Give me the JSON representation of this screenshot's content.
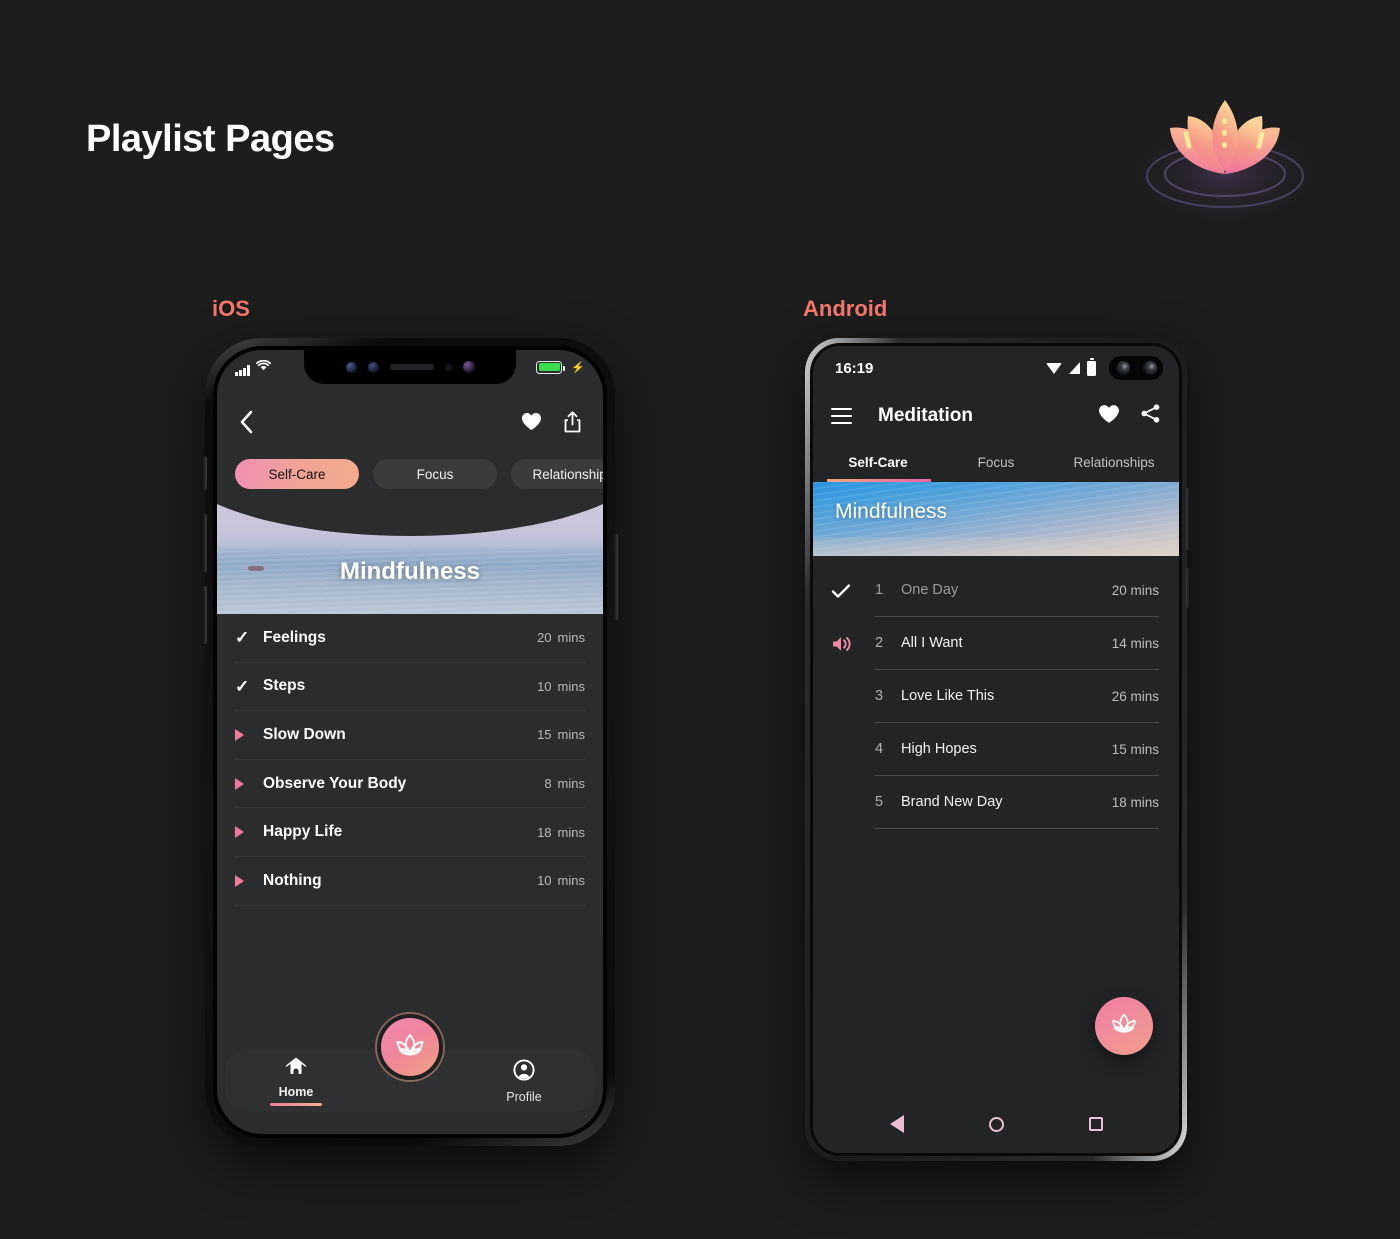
{
  "header": {
    "title": "Playlist Pages",
    "logo_icon": "lotus-logo"
  },
  "platform_labels": {
    "ios": "iOS",
    "android": "Android"
  },
  "colors": {
    "page_bg": "#1d1d1e",
    "screen_bg": "#232425",
    "accent_pink": "#ee7d9f",
    "accent_peach": "#f4b08d",
    "label_red": "#f2786b",
    "battery_green": "#3ddc4e"
  },
  "ios": {
    "status_bar": {
      "signal_icon": "signal-bars-icon",
      "wifi_icon": "wifi-icon",
      "battery_icon": "battery-icon",
      "charging_icon": "charging-bolt-icon"
    },
    "nav": {
      "back_icon": "chevron-left-icon",
      "favorite_icon": "heart-icon",
      "share_icon": "share-icon"
    },
    "tabs": [
      {
        "label": "Self-Care",
        "active": true
      },
      {
        "label": "Focus",
        "active": false
      },
      {
        "label": "Relationships",
        "active": false
      }
    ],
    "hero": {
      "title": "Mindfulness"
    },
    "tracks": [
      {
        "name": "Feelings",
        "duration": "20",
        "unit": "mins",
        "state": "done",
        "icon": "check-icon"
      },
      {
        "name": "Steps",
        "duration": "10",
        "unit": "mins",
        "state": "done",
        "icon": "check-icon"
      },
      {
        "name": "Slow Down",
        "duration": "15",
        "unit": "mins",
        "state": "playable",
        "icon": "play-icon"
      },
      {
        "name": "Observe Your Body",
        "duration": "8",
        "unit": "mins",
        "state": "playable",
        "icon": "play-icon"
      },
      {
        "name": "Happy Life",
        "duration": "18",
        "unit": "mins",
        "state": "playable",
        "icon": "play-icon"
      },
      {
        "name": "Nothing",
        "duration": "10",
        "unit": "mins",
        "state": "playable",
        "icon": "play-icon"
      }
    ],
    "tabbar": {
      "home_label": "Home",
      "home_icon": "home-icon",
      "profile_label": "Profile",
      "profile_icon": "profile-icon",
      "fab_icon": "lotus-icon"
    }
  },
  "android": {
    "status_bar": {
      "time": "16:19",
      "wifi_icon": "wifi-icon",
      "signal_icon": "signal-icon",
      "battery_icon": "battery-icon",
      "camera_icon": "punch-hole-camera"
    },
    "appbar": {
      "menu_icon": "hamburger-menu-icon",
      "title": "Meditation",
      "favorite_icon": "heart-icon",
      "share_icon": "share-icon"
    },
    "tabs": [
      {
        "label": "Self-Care",
        "active": true
      },
      {
        "label": "Focus",
        "active": false
      },
      {
        "label": "Relationships",
        "active": false
      }
    ],
    "hero": {
      "title": "Mindfulness"
    },
    "tracks": [
      {
        "num": "1",
        "name": "One Day",
        "duration": "20 mins",
        "state": "done",
        "icon": "check-icon"
      },
      {
        "num": "2",
        "name": "All I Want",
        "duration": "14 mins",
        "state": "playing",
        "icon": "speaker-icon"
      },
      {
        "num": "3",
        "name": "Love Like This",
        "duration": "26 mins",
        "state": "idle",
        "icon": ""
      },
      {
        "num": "4",
        "name": "High Hopes",
        "duration": "15 mins",
        "state": "idle",
        "icon": ""
      },
      {
        "num": "5",
        "name": "Brand New Day",
        "duration": "18 mins",
        "state": "idle",
        "icon": ""
      }
    ],
    "fab": {
      "icon": "lotus-icon"
    },
    "navbar": {
      "back_icon": "nav-back-icon",
      "home_icon": "nav-home-icon",
      "recents_icon": "nav-recents-icon"
    }
  }
}
